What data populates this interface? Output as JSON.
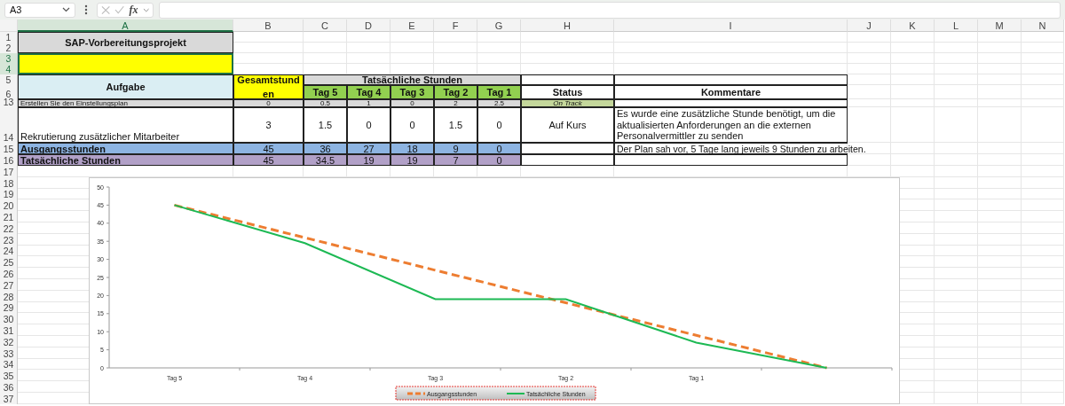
{
  "formula_bar": {
    "name_box": "A3",
    "function_label": "fx"
  },
  "column_headers": [
    {
      "label": "A",
      "selected": true
    },
    {
      "label": "B",
      "selected": false
    },
    {
      "label": "C",
      "selected": false
    },
    {
      "label": "D",
      "selected": false
    },
    {
      "label": "E",
      "selected": false
    },
    {
      "label": "F",
      "selected": false
    },
    {
      "label": "G",
      "selected": false
    },
    {
      "label": "H",
      "selected": false
    },
    {
      "label": "I",
      "selected": false
    },
    {
      "label": "J",
      "selected": false
    },
    {
      "label": "K",
      "selected": false
    },
    {
      "label": "L",
      "selected": false
    },
    {
      "label": "M",
      "selected": false
    },
    {
      "label": "N",
      "selected": false
    }
  ],
  "row_headers": [
    {
      "label": "1",
      "selected": false
    },
    {
      "label": "2",
      "selected": false
    },
    {
      "label": "3",
      "selected": true
    },
    {
      "label": "4",
      "selected": true
    },
    {
      "label": "5",
      "selected": false
    },
    {
      "label": "6",
      "selected": false
    },
    {
      "label": "13",
      "selected": false
    },
    {
      "label": "14",
      "selected": false
    },
    {
      "label": "15",
      "selected": false
    },
    {
      "label": "16",
      "selected": false
    },
    {
      "label": "17",
      "selected": false
    },
    {
      "label": "18",
      "selected": false
    },
    {
      "label": "19",
      "selected": false
    },
    {
      "label": "20",
      "selected": false
    },
    {
      "label": "21",
      "selected": false
    },
    {
      "label": "22",
      "selected": false
    },
    {
      "label": "23",
      "selected": false
    },
    {
      "label": "24",
      "selected": false
    },
    {
      "label": "25",
      "selected": false
    },
    {
      "label": "26",
      "selected": false
    },
    {
      "label": "27",
      "selected": false
    },
    {
      "label": "28",
      "selected": false
    },
    {
      "label": "29",
      "selected": false
    },
    {
      "label": "30",
      "selected": false
    },
    {
      "label": "31",
      "selected": false
    },
    {
      "label": "32",
      "selected": false
    },
    {
      "label": "33",
      "selected": false
    },
    {
      "label": "34",
      "selected": false
    },
    {
      "label": "35",
      "selected": false
    },
    {
      "label": "36",
      "selected": false
    },
    {
      "label": "37",
      "selected": false
    }
  ],
  "title": "SAP-Vorbereitungsprojekt",
  "header": {
    "task": "Aufgabe",
    "total": "Gesamtstunden",
    "group": "Tatsächliche Stunden",
    "days": [
      "Tag 5",
      "Tag 4",
      "Tag 3",
      "Tag 2",
      "Tag 1"
    ],
    "status": "Status",
    "comments": "Kommentare"
  },
  "rows": [
    {
      "kind": "task",
      "color": "#d9d9d9",
      "task": "Erstellen Sie den Einstellungsplan",
      "total": "0",
      "days": [
        "0.5",
        "1",
        "0",
        "2",
        "2.5"
      ],
      "status": {
        "text": "On Track",
        "color": "#c4d79b"
      }
    },
    {
      "kind": "task",
      "color": "#ffffff",
      "task": "Rekrutierung zusätzlicher Mitarbeiter",
      "total": "3",
      "days": [
        "1.5",
        "0",
        "0",
        "1.5",
        "0"
      ],
      "status": {
        "text": "Auf Kurs",
        "color": "#ffffff"
      },
      "comment": "Es wurde eine zusätzliche Stunde benötigt, um die aktualisierten Anforderungen an die externen Personalvermittler zu senden"
    },
    {
      "kind": "summary",
      "color": "#8db4e2",
      "task": "Ausgangsstunden",
      "total": "45",
      "days": [
        "36",
        "27",
        "18",
        "9",
        "0"
      ],
      "comment": "Der Plan sah vor, 5 Tage lang jeweils 9 Stunden zu arbeiten."
    },
    {
      "kind": "summary",
      "color": "#b1a0c7",
      "task": "Tatsächliche Stunden",
      "total": "45",
      "days": [
        "34.5",
        "19",
        "19",
        "7",
        "0"
      ]
    }
  ],
  "chart": {
    "chart_data": {
      "type": "line",
      "categories": [
        "Tag 5",
        "Tag 4",
        "Tag 3",
        "Tag 2",
        "Tag 1",
        null
      ],
      "ylim": [
        0,
        50
      ],
      "yticks": [
        0,
        5,
        10,
        15,
        20,
        25,
        30,
        35,
        40,
        45,
        50
      ],
      "legend": true,
      "series": [
        {
          "name": "Ausgangsstunden",
          "color": "#ed7d31",
          "line_style": "dashed",
          "values": [
            45,
            36,
            27,
            18,
            9,
            0
          ]
        },
        {
          "name": "Tatsächliche Stunden",
          "color": "#1db954",
          "line_style": "solid",
          "values": [
            45,
            34.5,
            19,
            19,
            7,
            0
          ]
        }
      ]
    }
  }
}
